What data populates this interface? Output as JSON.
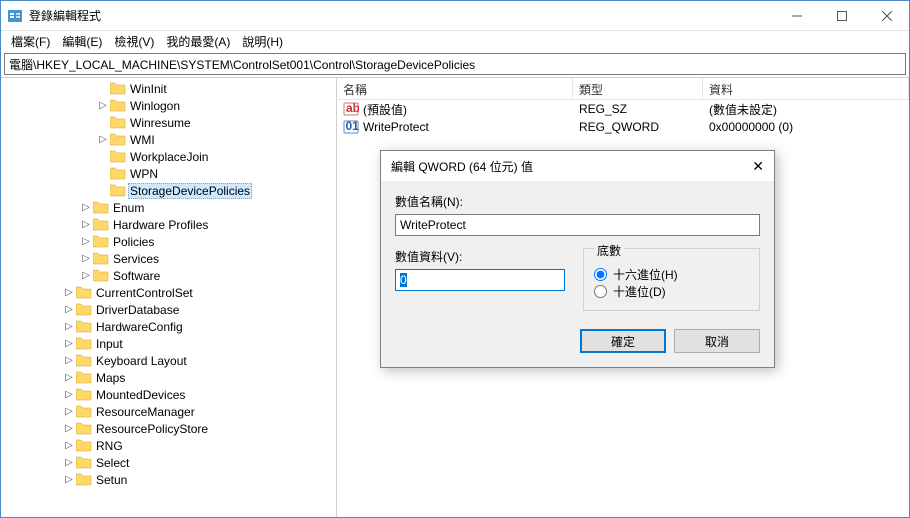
{
  "window": {
    "title": "登錄編輯程式"
  },
  "menu": {
    "file": "檔案(F)",
    "edit": "編輯(E)",
    "view": "檢視(V)",
    "favorites": "我的最愛(A)",
    "help": "說明(H)"
  },
  "address": "電腦\\HKEY_LOCAL_MACHINE\\SYSTEM\\ControlSet001\\Control\\StorageDevicePolicies",
  "tree": [
    {
      "depth": 5,
      "exp": "",
      "label": "WinInit"
    },
    {
      "depth": 5,
      "exp": ">",
      "label": "Winlogon"
    },
    {
      "depth": 5,
      "exp": "",
      "label": "Winresume"
    },
    {
      "depth": 5,
      "exp": ">",
      "label": "WMI"
    },
    {
      "depth": 5,
      "exp": "",
      "label": "WorkplaceJoin"
    },
    {
      "depth": 5,
      "exp": "",
      "label": "WPN"
    },
    {
      "depth": 5,
      "exp": "",
      "label": "StorageDevicePolicies",
      "selected": true
    },
    {
      "depth": 4,
      "exp": ">",
      "label": "Enum"
    },
    {
      "depth": 4,
      "exp": ">",
      "label": "Hardware Profiles"
    },
    {
      "depth": 4,
      "exp": ">",
      "label": "Policies"
    },
    {
      "depth": 4,
      "exp": ">",
      "label": "Services"
    },
    {
      "depth": 4,
      "exp": ">",
      "label": "Software"
    },
    {
      "depth": 3,
      "exp": ">",
      "label": "CurrentControlSet"
    },
    {
      "depth": 3,
      "exp": ">",
      "label": "DriverDatabase"
    },
    {
      "depth": 3,
      "exp": ">",
      "label": "HardwareConfig"
    },
    {
      "depth": 3,
      "exp": ">",
      "label": "Input"
    },
    {
      "depth": 3,
      "exp": ">",
      "label": "Keyboard Layout"
    },
    {
      "depth": 3,
      "exp": ">",
      "label": "Maps"
    },
    {
      "depth": 3,
      "exp": ">",
      "label": "MountedDevices"
    },
    {
      "depth": 3,
      "exp": ">",
      "label": "ResourceManager"
    },
    {
      "depth": 3,
      "exp": ">",
      "label": "ResourcePolicyStore"
    },
    {
      "depth": 3,
      "exp": ">",
      "label": "RNG"
    },
    {
      "depth": 3,
      "exp": ">",
      "label": "Select"
    },
    {
      "depth": 3,
      "exp": ">",
      "label": "Setun"
    }
  ],
  "list": {
    "cols": {
      "name": "名稱",
      "type": "類型",
      "data": "資料"
    },
    "rows": [
      {
        "icon": "string",
        "name": "(預設值)",
        "type": "REG_SZ",
        "data": "(數值未設定)"
      },
      {
        "icon": "binary",
        "name": "WriteProtect",
        "type": "REG_QWORD",
        "data": "0x00000000 (0)"
      }
    ]
  },
  "dialog": {
    "title": "編輯 QWORD (64 位元) 值",
    "name_label": "數值名稱(N):",
    "name_value": "WriteProtect",
    "data_label": "數值資料(V):",
    "data_value": "0",
    "base_label": "底數",
    "hex_label": "十六進位(H)",
    "dec_label": "十進位(D)",
    "ok": "確定",
    "cancel": "取消"
  }
}
